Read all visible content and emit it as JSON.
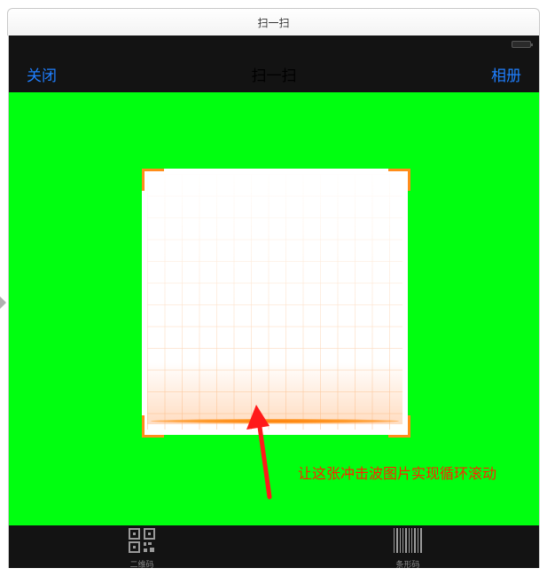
{
  "window": {
    "title": "扫一扫"
  },
  "nav": {
    "close_label": "关闭",
    "title": "扫一扫",
    "album_label": "相册"
  },
  "annotation": {
    "text": "让这张冲击波图片实现循环滚动"
  },
  "tabs": [
    {
      "label": "二维码",
      "icon": "qrcode-icon"
    },
    {
      "label": "条形码",
      "icon": "barcode-icon"
    }
  ],
  "colors": {
    "background": "#00ff10",
    "bar": "#131313",
    "link": "#1f7fff",
    "corner": "#ff8c1a",
    "annotation": "#ff2200"
  }
}
